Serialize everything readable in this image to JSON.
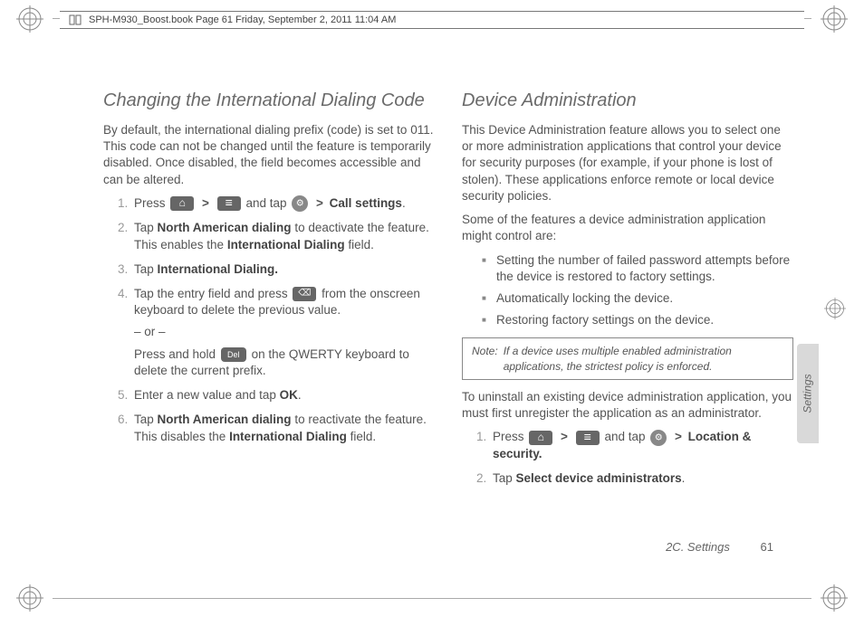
{
  "header": {
    "text": "SPH-M930_Boost.book  Page 61  Friday, September 2, 2011  11:04 AM"
  },
  "left": {
    "title": "Changing the International Dialing Code",
    "intro": "By default, the international dialing prefix (code) is set to 011. This code can not be changed until the feature is temporarily disabled. Once disabled, the field becomes accessible and can be altered.",
    "step1_pre": "Press ",
    "step1_mid": " and tap ",
    "step1_bold": "Call settings",
    "step1_end": ".",
    "step2_pre": "Tap ",
    "step2_bold1": "North American dialing",
    "step2_mid": " to deactivate the feature. This enables the ",
    "step2_bold2": "International Dialing",
    "step2_end": " field.",
    "step3_pre": "Tap ",
    "step3_bold": "International Dialing.",
    "step4_pre": "Tap the entry field and press ",
    "step4_mid": " from the onscreen keyboard to delete the previous value.",
    "step4_or": "– or –",
    "step4b_pre": "Press and hold ",
    "step4b_end": " on the QWERTY keyboard to delete the current prefix.",
    "step5_pre": "Enter a new value and tap ",
    "step5_bold": "OK",
    "step5_end": ".",
    "step6_pre": "Tap ",
    "step6_bold1": "North American dialing",
    "step6_mid": " to reactivate the feature. This disables the ",
    "step6_bold2": "International Dialing",
    "step6_end": " field."
  },
  "right": {
    "title": "Device Administration",
    "intro": "This Device Administration feature allows you to select one or more administration applications that control your device for security purposes (for example, if your phone is lost of stolen). These applications enforce remote or local device security policies.",
    "intro2": "Some of the features a device administration application might control are:",
    "b1": "Setting the number of failed password attempts before the device is restored to factory settings.",
    "b2": "Automatically locking the device.",
    "b3": "Restoring factory settings on the device.",
    "note_label": "Note:",
    "note_text": "If a device uses multiple enabled administration applications, the strictest policy is enforced.",
    "para3": "To uninstall an existing device administration application, you must first unregister the application as an administrator.",
    "rstep1_pre": "Press ",
    "rstep1_mid": " and tap ",
    "rstep1_bold": "Location & security.",
    "rstep2_pre": "Tap ",
    "rstep2_bold": "Select device administrators",
    "rstep2_end": "."
  },
  "sidetab": "Settings",
  "footer": {
    "section": "2C. Settings",
    "page": "61"
  },
  "nums": {
    "n1": "1.",
    "n2": "2.",
    "n3": "3.",
    "n4": "4.",
    "n5": "5.",
    "n6": "6."
  },
  "gt": ">"
}
